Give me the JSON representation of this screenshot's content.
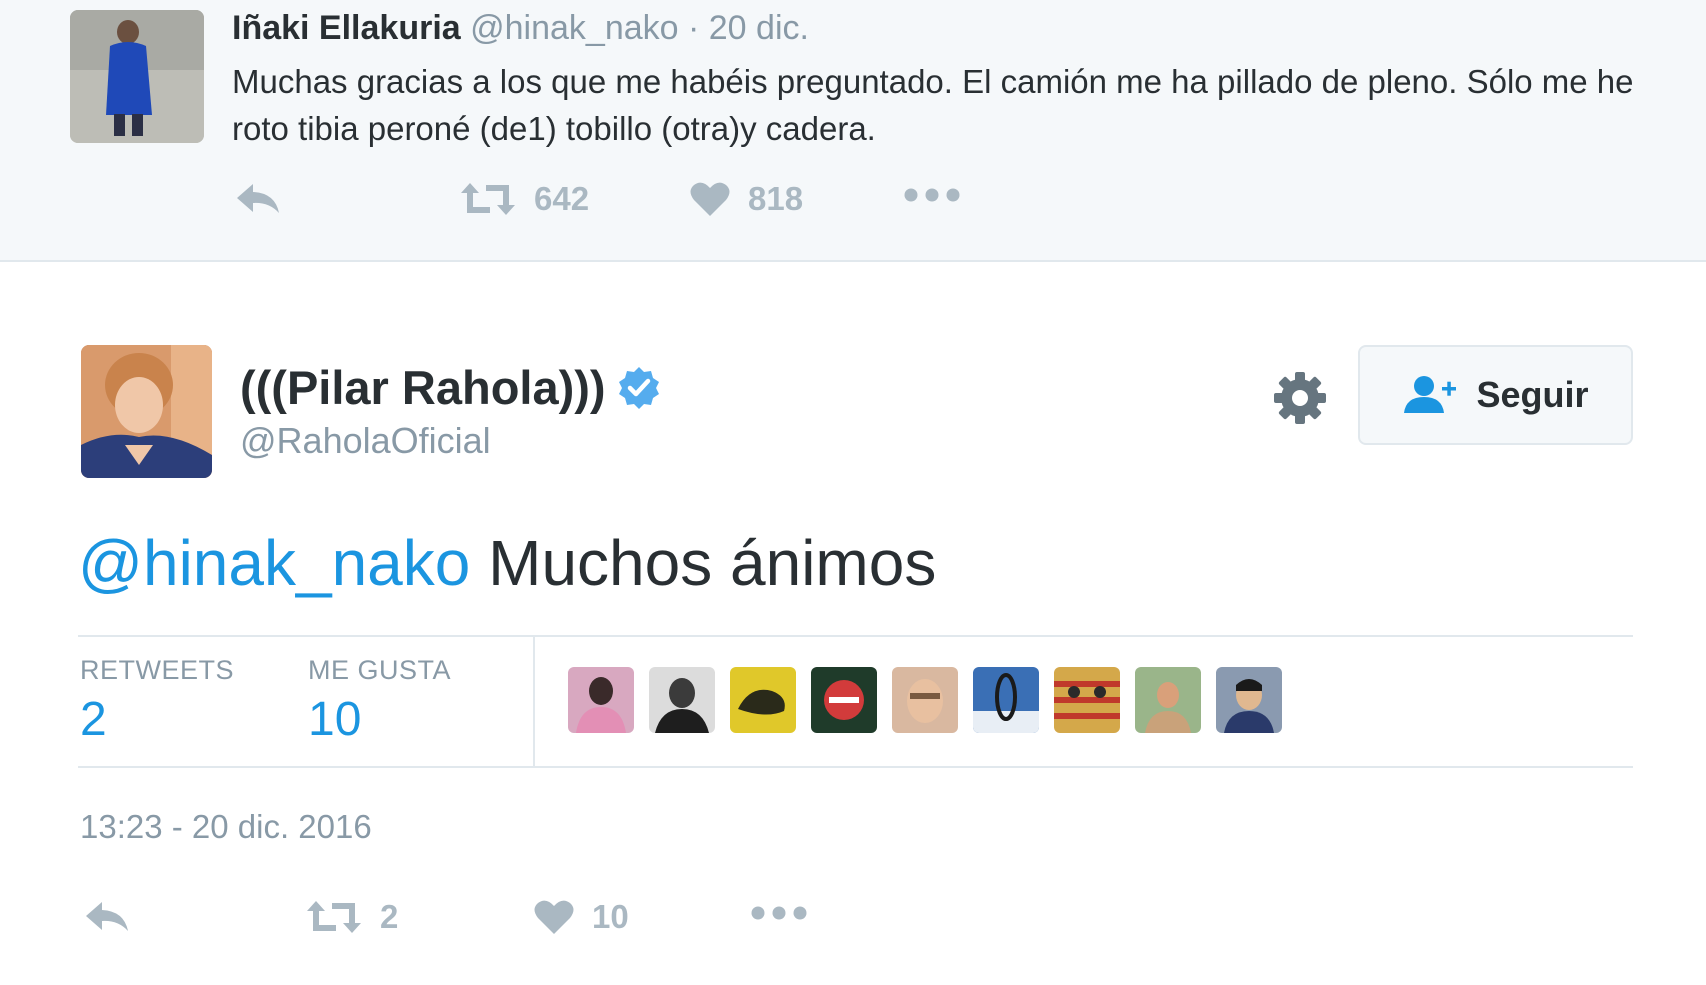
{
  "parent_tweet": {
    "author_name": "Iñaki Ellakuria",
    "handle_and_date": "@hinak_nako · 20 dic.",
    "text": "Muchas gracias a los que me habéis preguntado. El camión me ha pillado de pleno. Sólo me he roto tibia peroné (de1) tobillo (otra)y cadera.",
    "retweets": "642",
    "likes": "818",
    "icons": {
      "reply": "reply-icon",
      "retweet": "retweet-icon",
      "like": "heart-icon",
      "more": "more-icon"
    }
  },
  "main_tweet": {
    "author_name": "(((Pilar Rahola)))",
    "verified_icon": "verified-badge-icon",
    "handle": "@RaholaOficial",
    "follow_label": "Seguir",
    "mention": "@hinak_nako",
    "text": " Muchos ánimos",
    "stats": {
      "retweets_label": "RETWEETS",
      "retweets_value": "2",
      "likes_label": "ME GUSTA",
      "likes_value": "10"
    },
    "timestamp": "13:23 - 20 dic. 2016",
    "retweets": "2",
    "likes": "10"
  },
  "colors": {
    "accent": "#1b95e0",
    "muted": "#8899a6",
    "action_icon": "#aab8c2",
    "text": "#292f33",
    "parent_background": "#f5f8fa"
  }
}
